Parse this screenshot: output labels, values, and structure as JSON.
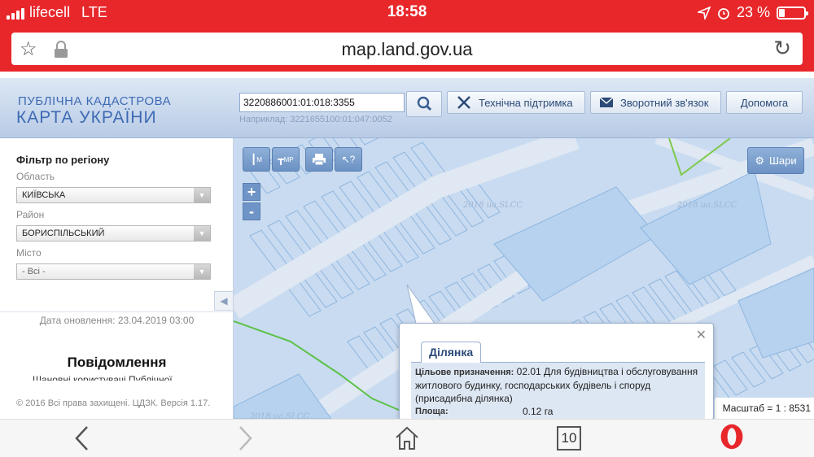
{
  "status_bar": {
    "carrier": "lifecell",
    "network": "LTE",
    "time": "18:58",
    "battery": "23 %",
    "battery_level": 0.23
  },
  "browser": {
    "url": "map.land.gov.ua",
    "bookmark_icon": "star-icon",
    "lock_icon": "lock-icon",
    "reload_icon": "reload-icon"
  },
  "header": {
    "logo_line1": "ПУБЛІЧНА КАДАСТРОВА",
    "logo_line2": "КАРТА УКРАЇНИ",
    "search_value": "3220886001:01:018:3355",
    "search_hint": "Наприклад: 3221655100:01:047:0052",
    "support_label": "Технічна підтримка",
    "feedback_label": "Зворотний зв'язок",
    "help_label": "Допомога"
  },
  "sidebar": {
    "title": "Фільтр по регіону",
    "region_label": "Область",
    "region_value": "КИЇВСЬКА",
    "district_label": "Район",
    "district_value": "БОРИСПІЛЬСЬКИЙ",
    "city_label": "Місто",
    "city_value": "- Всі -",
    "update_text": "Дата оновлення: 23.04.2019 03:00",
    "notices_title": "Повідомлення",
    "notices_partial": "Шановні користувачі Публічної",
    "copyright": "© 2016 Всі права захищені. ЦДЗК. Версія 1.17."
  },
  "map": {
    "tools": [
      "М",
      "МР"
    ],
    "layers_label": "Шари",
    "zoom_in": "+",
    "zoom_out": "-",
    "scale_text": "Масштаб = 1 : 8531",
    "watermarks": [
      "2018 ua.SLCC",
      "2018 ua.SLCC",
      "2018 ua.SLCC"
    ]
  },
  "popup": {
    "tab_label": "Ділянка",
    "close": "✕",
    "purpose_key": "Цільове призначення:",
    "purpose_value": "02.01 Для будівництва і обслуговування житлового будинку, господарських будівель і споруд (присадибна ділянка)",
    "area_key": "Площа:",
    "area_value": "0.12 га"
  },
  "bottom_bar": {
    "tabs_count": "10"
  },
  "colors": {
    "status_red": "#e8272b",
    "header_blue": "#3f6bb4",
    "map_bg": "#c9dbf0",
    "parcel_line": "#8fb6e0",
    "green_line": "#5cc24a"
  }
}
